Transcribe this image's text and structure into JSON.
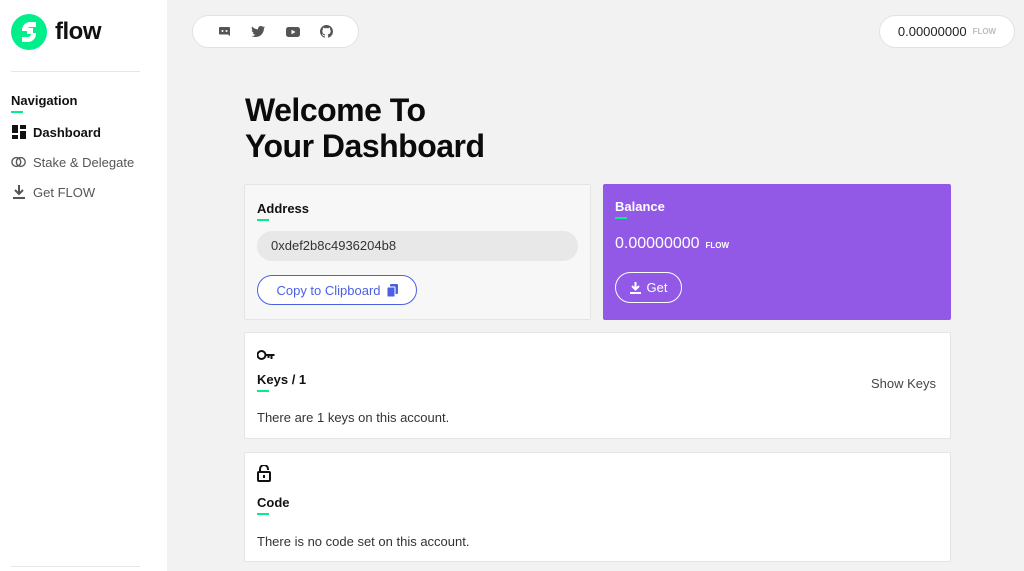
{
  "brand": {
    "name": "flow"
  },
  "sidebar": {
    "heading": "Navigation",
    "items": [
      {
        "label": "Dashboard",
        "icon": "dashboard-icon",
        "active": true
      },
      {
        "label": "Stake & Delegate",
        "icon": "stake-icon",
        "active": false
      },
      {
        "label": "Get FLOW",
        "icon": "download-icon",
        "active": false
      }
    ]
  },
  "social": [
    "discord-icon",
    "twitter-icon",
    "youtube-icon",
    "github-icon"
  ],
  "header": {
    "balance": "0.00000000",
    "unit": "FLOW"
  },
  "main": {
    "title_line1": "Welcome To",
    "title_line2": "Your Dashboard",
    "address": {
      "label": "Address",
      "value": "0xdef2b8c4936204b8",
      "copy_label": "Copy to Clipboard"
    },
    "balance": {
      "label": "Balance",
      "amount": "0.00000000",
      "unit": "FLOW",
      "get_label": "Get"
    },
    "keys": {
      "label": "Keys / 1",
      "show_label": "Show Keys",
      "text": "There are 1 keys on this account."
    },
    "code": {
      "label": "Code",
      "text": "There is no code set on this account."
    }
  },
  "colors": {
    "accent": "#00ef8b",
    "purple": "#9259e6",
    "link": "#4b61e3"
  }
}
